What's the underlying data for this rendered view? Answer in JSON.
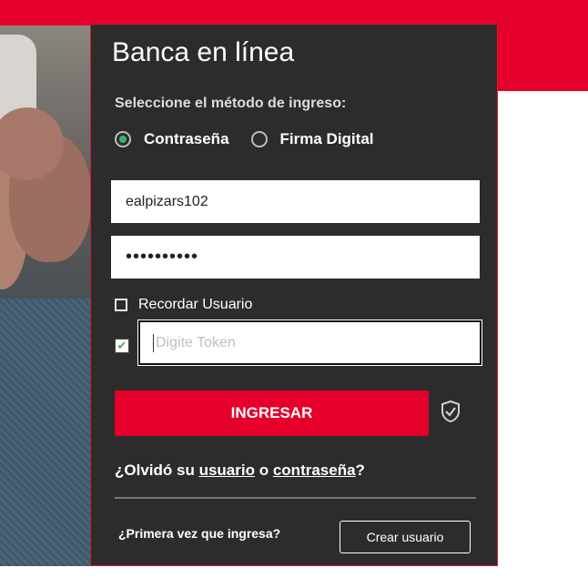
{
  "panel": {
    "title": "Banca en línea",
    "method_label": "Seleccione el método de ingreso:",
    "options": [
      {
        "label": "Contraseña",
        "selected": true
      },
      {
        "label": "Firma Digital",
        "selected": false
      }
    ],
    "username_value": "ealpizars102",
    "password_value": "••••••••••",
    "remember_label": "Recordar Usuario",
    "remember_checked": false,
    "token_checked": true,
    "token_placeholder": "Digite Token",
    "submit_label": "INGRESAR",
    "forgot": {
      "prefix": "¿Olvidó su",
      "user_link": "usuario",
      "middle": "o",
      "password_link": "contraseña",
      "suffix": "?"
    },
    "first_time_label": "¿Primera vez que ingresa?",
    "create_user_label": "Crear usuario"
  },
  "colors": {
    "brand_red": "#e4002b",
    "panel_bg": "#2d2c2c",
    "radio_selected": "#3bb273"
  }
}
